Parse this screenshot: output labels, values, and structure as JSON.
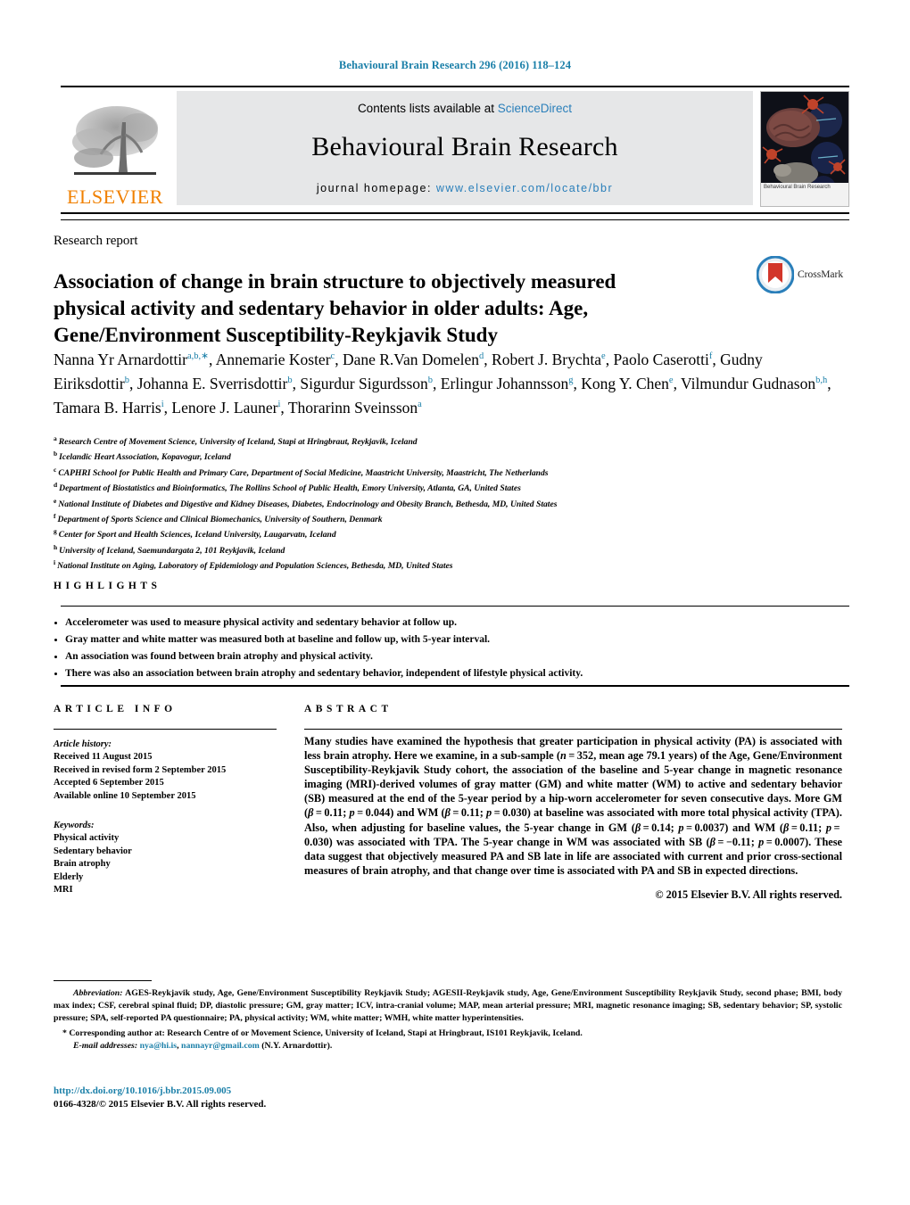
{
  "header": {
    "running_head": "Behavioural Brain Research 296 (2016) 118–124",
    "contents_prefix": "Contents lists available at ",
    "contents_link": "ScienceDirect",
    "journal_title": "Behavioural Brain Research",
    "homepage_prefix": "journal homepage: ",
    "homepage_url": "www.elsevier.com/locate/bbr",
    "publisher_logo_word": "ELSEVIER",
    "cover_caption": "Behavioural Brain Research",
    "brand_colors": {
      "elsevier_orange": "#f08000",
      "link_blue": "#2a7fba",
      "running_head_teal": "#1a7fa8",
      "band_gray": "#e6e7e8"
    }
  },
  "article": {
    "type": "Research report",
    "title": "Association of change in brain structure to objectively measured physical activity and sedentary behavior in older adults: Age, Gene/Environment Susceptibility-Reykjavik Study",
    "crossmark_label": "CrossMark",
    "authors_html": "Nanna Yr Arnardottir<sup>a,b,∗</sup>, Annemarie Koster<sup>c</sup>, Dane R.Van Domelen<sup>d</sup>, Robert J. Brychta<sup>e</sup>, Paolo Caserotti<sup>f</sup>, Gudny Eiriksdottir<sup>b</sup>, Johanna E. Sverrisdottir<sup>b</sup>, Sigurdur Sigurdsson<sup>b</sup>, Erlingur Johannsson<sup>g</sup>, Kong Y. Chen<sup>e</sup>, Vilmundur Gudnason<sup>b,h</sup>, Tamara B. Harris<sup>i</sup>, Lenore J. Launer<sup>i</sup>, Thorarinn Sveinsson<sup>a</sup>"
  },
  "affiliations": [
    {
      "marker": "a",
      "text": "Research Centre of Movement Science, University of Iceland, Stapi at Hringbraut, Reykjavik, Iceland"
    },
    {
      "marker": "b",
      "text": "Icelandic Heart Association, Kopavogur, Iceland"
    },
    {
      "marker": "c",
      "text": "CAPHRI School for Public Health and Primary Care, Department of Social Medicine, Maastricht University, Maastricht, The Netherlands"
    },
    {
      "marker": "d",
      "text": "Department of Biostatistics and Bioinformatics, The Rollins School of Public Health, Emory University, Atlanta, GA, United States"
    },
    {
      "marker": "e",
      "text": "National Institute of Diabetes and Digestive and Kidney Diseases, Diabetes, Endocrinology and Obesity Branch, Bethesda, MD, United States"
    },
    {
      "marker": "f",
      "text": "Department of Sports Science and Clinical Biomechanics, University of Southern, Denmark"
    },
    {
      "marker": "g",
      "text": "Center for Sport and Health Sciences, Iceland University, Laugarvatn, Iceland"
    },
    {
      "marker": "h",
      "text": "University of Iceland, Saemundargata 2, 101 Reykjavik, Iceland"
    },
    {
      "marker": "i",
      "text": "National Institute on Aging, Laboratory of Epidemiology and Population Sciences, Bethesda, MD, United States"
    }
  ],
  "highlights": {
    "heading": "HIGHLIGHTS",
    "items": [
      "Accelerometer was used to measure physical activity and sedentary behavior at follow up.",
      "Gray matter and white matter was measured both at baseline and follow up, with 5-year interval.",
      "An association was found between brain atrophy and physical activity.",
      "There was also an association between brain atrophy and sedentary behavior, independent of lifestyle physical activity."
    ]
  },
  "article_info": {
    "heading": "ARTICLE INFO",
    "history_label": "Article history:",
    "history": [
      "Received 11 August 2015",
      "Received in revised form 2 September 2015",
      "Accepted 6 September 2015",
      "Available online 10 September 2015"
    ],
    "keywords_label": "Keywords:",
    "keywords": [
      "Physical activity",
      "Sedentary behavior",
      "Brain atrophy",
      "Elderly",
      "MRI"
    ]
  },
  "abstract": {
    "heading": "ABSTRACT",
    "body_html": "Many studies have examined the hypothesis that greater participation in physical activity (PA) is associated with less brain atrophy. Here we examine, in a sub-sample (<i>n</i> = 352, mean age 79.1 years) of the Age, Gene/Environment Susceptibility-Reykjavik Study cohort, the association of the baseline and 5-year change in magnetic resonance imaging (MRI)-derived volumes of gray matter (GM) and white matter (WM) to active and sedentary behavior (SB) measured at the end of the 5-year period by a hip-worn accelerometer for seven consecutive days. More GM (<i>β</i> = 0.11; <i>p</i> = 0.044) and WM (<i>β</i> = 0.11; <i>p</i> = 0.030) at baseline was associated with more total physical activity (TPA). Also, when adjusting for baseline values, the 5-year change in GM (<i>β</i> = 0.14; <i>p</i> = 0.0037) and WM (<i>β</i> = 0.11; <i>p</i> = 0.030) was associated with TPA. The 5-year change in WM was associated with SB (<i>β</i> = −0.11; <i>p</i> = 0.0007). These data suggest that objectively measured PA and SB late in life are associated with current and prior cross-sectional measures of brain atrophy, and that change over time is associated with PA and SB in expected directions.",
    "copyright": "© 2015 Elsevier B.V. All rights reserved."
  },
  "footnotes": {
    "abbreviation_label": "Abbreviation:",
    "abbreviation_text": "AGES-Reykjavik study, Age, Gene/Environment Susceptibility Reykjavik Study; AGESII-Reykjavik study, Age, Gene/Environment Susceptibility Reykjavik Study, second phase; BMI, body max index; CSF, cerebral spinal fluid; DP, diastolic pressure; GM, gray matter; ICV, intra-cranial volume; MAP, mean arterial pressure; MRI, magnetic resonance imaging; SB, sedentary behavior; SP, systolic pressure; SPA, self-reported PA questionnaire; PA, physical activity; WM, white matter; WMH, white matter hyperintensities.",
    "corresponding": "Corresponding author at: Research Centre of or Movement Science, University of Iceland, Stapi at Hringbraut, IS101 Reykjavik, Iceland.",
    "email_label": "E-mail addresses:",
    "emails": [
      "nya@hi.is",
      "nannayr@gmail.com"
    ],
    "email_suffix": "(N.Y. Arnardottir)."
  },
  "footer": {
    "doi_url": "http://dx.doi.org/10.1016/j.bbr.2015.09.005",
    "issn_line": "0166-4328/© 2015 Elsevier B.V. All rights reserved."
  }
}
